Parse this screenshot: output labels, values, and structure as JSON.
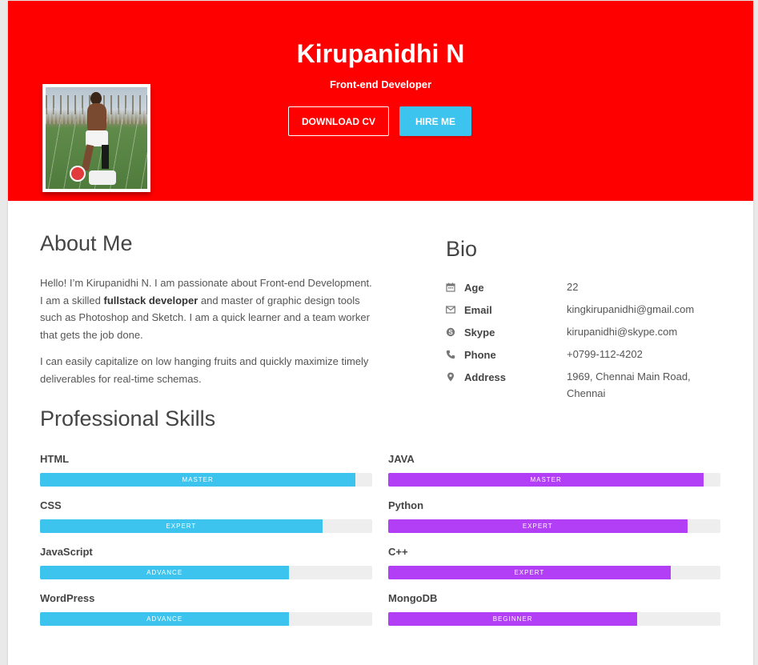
{
  "header": {
    "name": "Kirupanidhi N",
    "role": "Front-end Developer",
    "download_label": "DOWNLOAD CV",
    "hire_label": "HIRE ME",
    "background_color": "#ff0000"
  },
  "about": {
    "title": "About Me",
    "para1_before": "Hello! I’m Kirupanidhi N. I am passionate about Front-end Development. I am a skilled ",
    "para1_bold": "fullstack developer",
    "para1_after": " and master of graphic design tools such as Photoshop and Sketch. I am a quick learner and a team worker that gets the job done.",
    "para2": "I can easily capitalize on low hanging fruits and quickly maximize timely deliverables for real-time schemas."
  },
  "bio": {
    "title": "Bio",
    "rows": [
      {
        "icon": "calendar-icon",
        "label": "Age",
        "value": "22"
      },
      {
        "icon": "envelope-icon",
        "label": "Email",
        "value": "kingkirupanidhi@gmail.com"
      },
      {
        "icon": "skype-icon",
        "label": "Skype",
        "value": "kirupanidhi@skype.com"
      },
      {
        "icon": "phone-icon",
        "label": "Phone",
        "value": "+0799-112-4202"
      },
      {
        "icon": "map-pin-icon",
        "label": "Address",
        "value": "1969, Chennai Main Road, Chennai"
      }
    ]
  },
  "skills": {
    "title": "Professional Skills",
    "left_color": "#3cc3ee",
    "right_color": "#b23ef5",
    "left": [
      {
        "name": "HTML",
        "level": "MASTER",
        "percent": 95
      },
      {
        "name": "CSS",
        "level": "EXPERT",
        "percent": 85
      },
      {
        "name": "JavaScript",
        "level": "ADVANCE",
        "percent": 75
      },
      {
        "name": "WordPress",
        "level": "ADVANCE",
        "percent": 75
      }
    ],
    "right": [
      {
        "name": "JAVA",
        "level": "MASTER",
        "percent": 95
      },
      {
        "name": "Python",
        "level": "EXPERT",
        "percent": 90
      },
      {
        "name": "C++",
        "level": "EXPERT",
        "percent": 85
      },
      {
        "name": "MongoDB",
        "level": "BEGINNER",
        "percent": 75
      }
    ]
  }
}
